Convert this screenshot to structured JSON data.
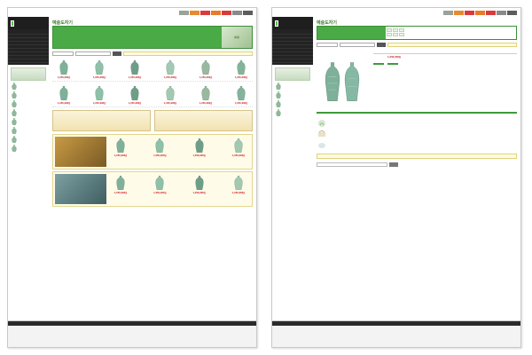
{
  "colors": {
    "accent": "#4aab46",
    "dark": "#232323",
    "price": "#d0272d",
    "gold": "#e0d27a",
    "nav_colors": [
      "#9aa29a",
      "#e88a2f",
      "#d93b3b",
      "#e87a2a",
      "#d93b3b",
      "#8a8a8a",
      "#5c5c5c"
    ]
  },
  "top_nav": [
    "",
    "",
    "",
    "",
    "",
    "",
    ""
  ],
  "logo_text": "",
  "left": {
    "page_title": "예술도자기",
    "breadcrumb": "",
    "menu": [
      "",
      "",
      "",
      "",
      "",
      "",
      "",
      "",
      ""
    ],
    "side_banner": "",
    "side_products": [
      {
        "name": "",
        "price": ""
      },
      {
        "name": "",
        "price": ""
      },
      {
        "name": "",
        "price": ""
      },
      {
        "name": "",
        "price": ""
      },
      {
        "name": "",
        "price": ""
      },
      {
        "name": "",
        "price": ""
      },
      {
        "name": "",
        "price": ""
      },
      {
        "name": "",
        "price": ""
      }
    ],
    "banner_lines": [
      "",
      "",
      "",
      "",
      ""
    ],
    "banner_visual": "靑瓷",
    "search": {
      "select_label": "",
      "placeholder": "",
      "button": ""
    },
    "notice": "",
    "section_new": "",
    "row1": [
      {
        "name": "",
        "price": "1,950,000원"
      },
      {
        "name": "",
        "price": "1,950,000원"
      },
      {
        "name": "",
        "price": "1,950,000원"
      },
      {
        "name": "",
        "price": "1,950,000원"
      },
      {
        "name": "",
        "price": "1,950,000원"
      },
      {
        "name": "",
        "price": "1,950,000원"
      }
    ],
    "section_best": "",
    "row2": [
      {
        "name": "",
        "price": "1,950,000원"
      },
      {
        "name": "",
        "price": "1,950,000원"
      },
      {
        "name": "",
        "price": "1,950,000원"
      },
      {
        "name": "",
        "price": "1,950,000원"
      },
      {
        "name": "",
        "price": "1,950,000원"
      },
      {
        "name": "",
        "price": "1,950,000원"
      }
    ],
    "feature_left": "",
    "feature_right": "",
    "promo_title": "",
    "promo_lines": [
      "",
      "",
      ""
    ],
    "row3": [
      {
        "name": "",
        "price": "1,950,000원"
      },
      {
        "name": "",
        "price": "1,950,000원"
      },
      {
        "name": "",
        "price": "1,950,000원"
      },
      {
        "name": "",
        "price": "1,950,000원"
      }
    ],
    "promo2_title": "",
    "row4": [
      {
        "name": "",
        "price": "1,950,000원"
      },
      {
        "name": "",
        "price": "1,950,000원"
      },
      {
        "name": "",
        "price": "1,950,000원"
      },
      {
        "name": "",
        "price": "1,950,000원"
      }
    ]
  },
  "footer": {
    "links": [
      "",
      "",
      "",
      "",
      "",
      ""
    ],
    "logo": "",
    "info_lines": [
      "",
      "",
      ""
    ]
  },
  "right": {
    "page_title": "예술도자기",
    "sub_title": "",
    "tabs": [
      "",
      "",
      "",
      "",
      "",
      ""
    ],
    "product_title": "",
    "info": [
      {
        "key": "",
        "value": ""
      },
      {
        "key": "",
        "value": ""
      },
      {
        "key": "",
        "value": ""
      },
      {
        "key": "",
        "value": "1,950,000원"
      },
      {
        "key": "",
        "value": ""
      },
      {
        "key": "",
        "value": ""
      }
    ],
    "buttons": [
      "",
      ""
    ],
    "desc_head": "",
    "desc_lines": [
      "",
      "",
      "",
      "",
      "",
      ""
    ],
    "care_head": "",
    "care_items": [
      {
        "label": "",
        "text": ""
      },
      {
        "label": "",
        "text": ""
      },
      {
        "label": "",
        "text": ""
      }
    ],
    "qna_head": "",
    "qna_text": "",
    "comment_button": ""
  }
}
